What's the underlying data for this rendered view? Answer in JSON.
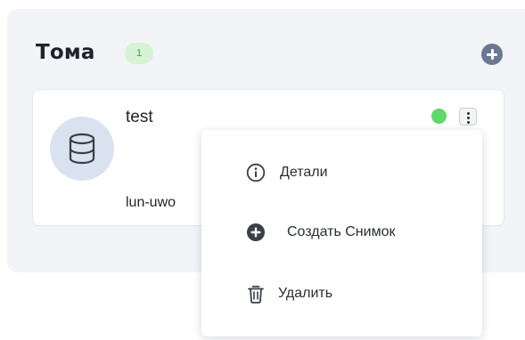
{
  "volumes_panel": {
    "title": "Тома",
    "count": "1",
    "add_icon": "plus-circle-icon"
  },
  "volume_card": {
    "name": "test",
    "lun": "lun-uwo",
    "icon": "database-icon",
    "status": "online",
    "status_color": "#5fd865",
    "menu_icon": "kebab-icon"
  },
  "context_menu": {
    "items": [
      {
        "label": "Детали",
        "icon": "info-icon"
      },
      {
        "label": "Создать Снимок",
        "icon": "plus-circle-icon"
      },
      {
        "label": "Удалить",
        "icon": "trash-icon"
      }
    ]
  },
  "colors": {
    "panel_bg": "#f2f4f8",
    "badge_bg": "#d7f2d4",
    "badge_text": "#3f9d47",
    "icon_gray": "#6b7891",
    "avatar_bg": "#d9e2ef"
  }
}
